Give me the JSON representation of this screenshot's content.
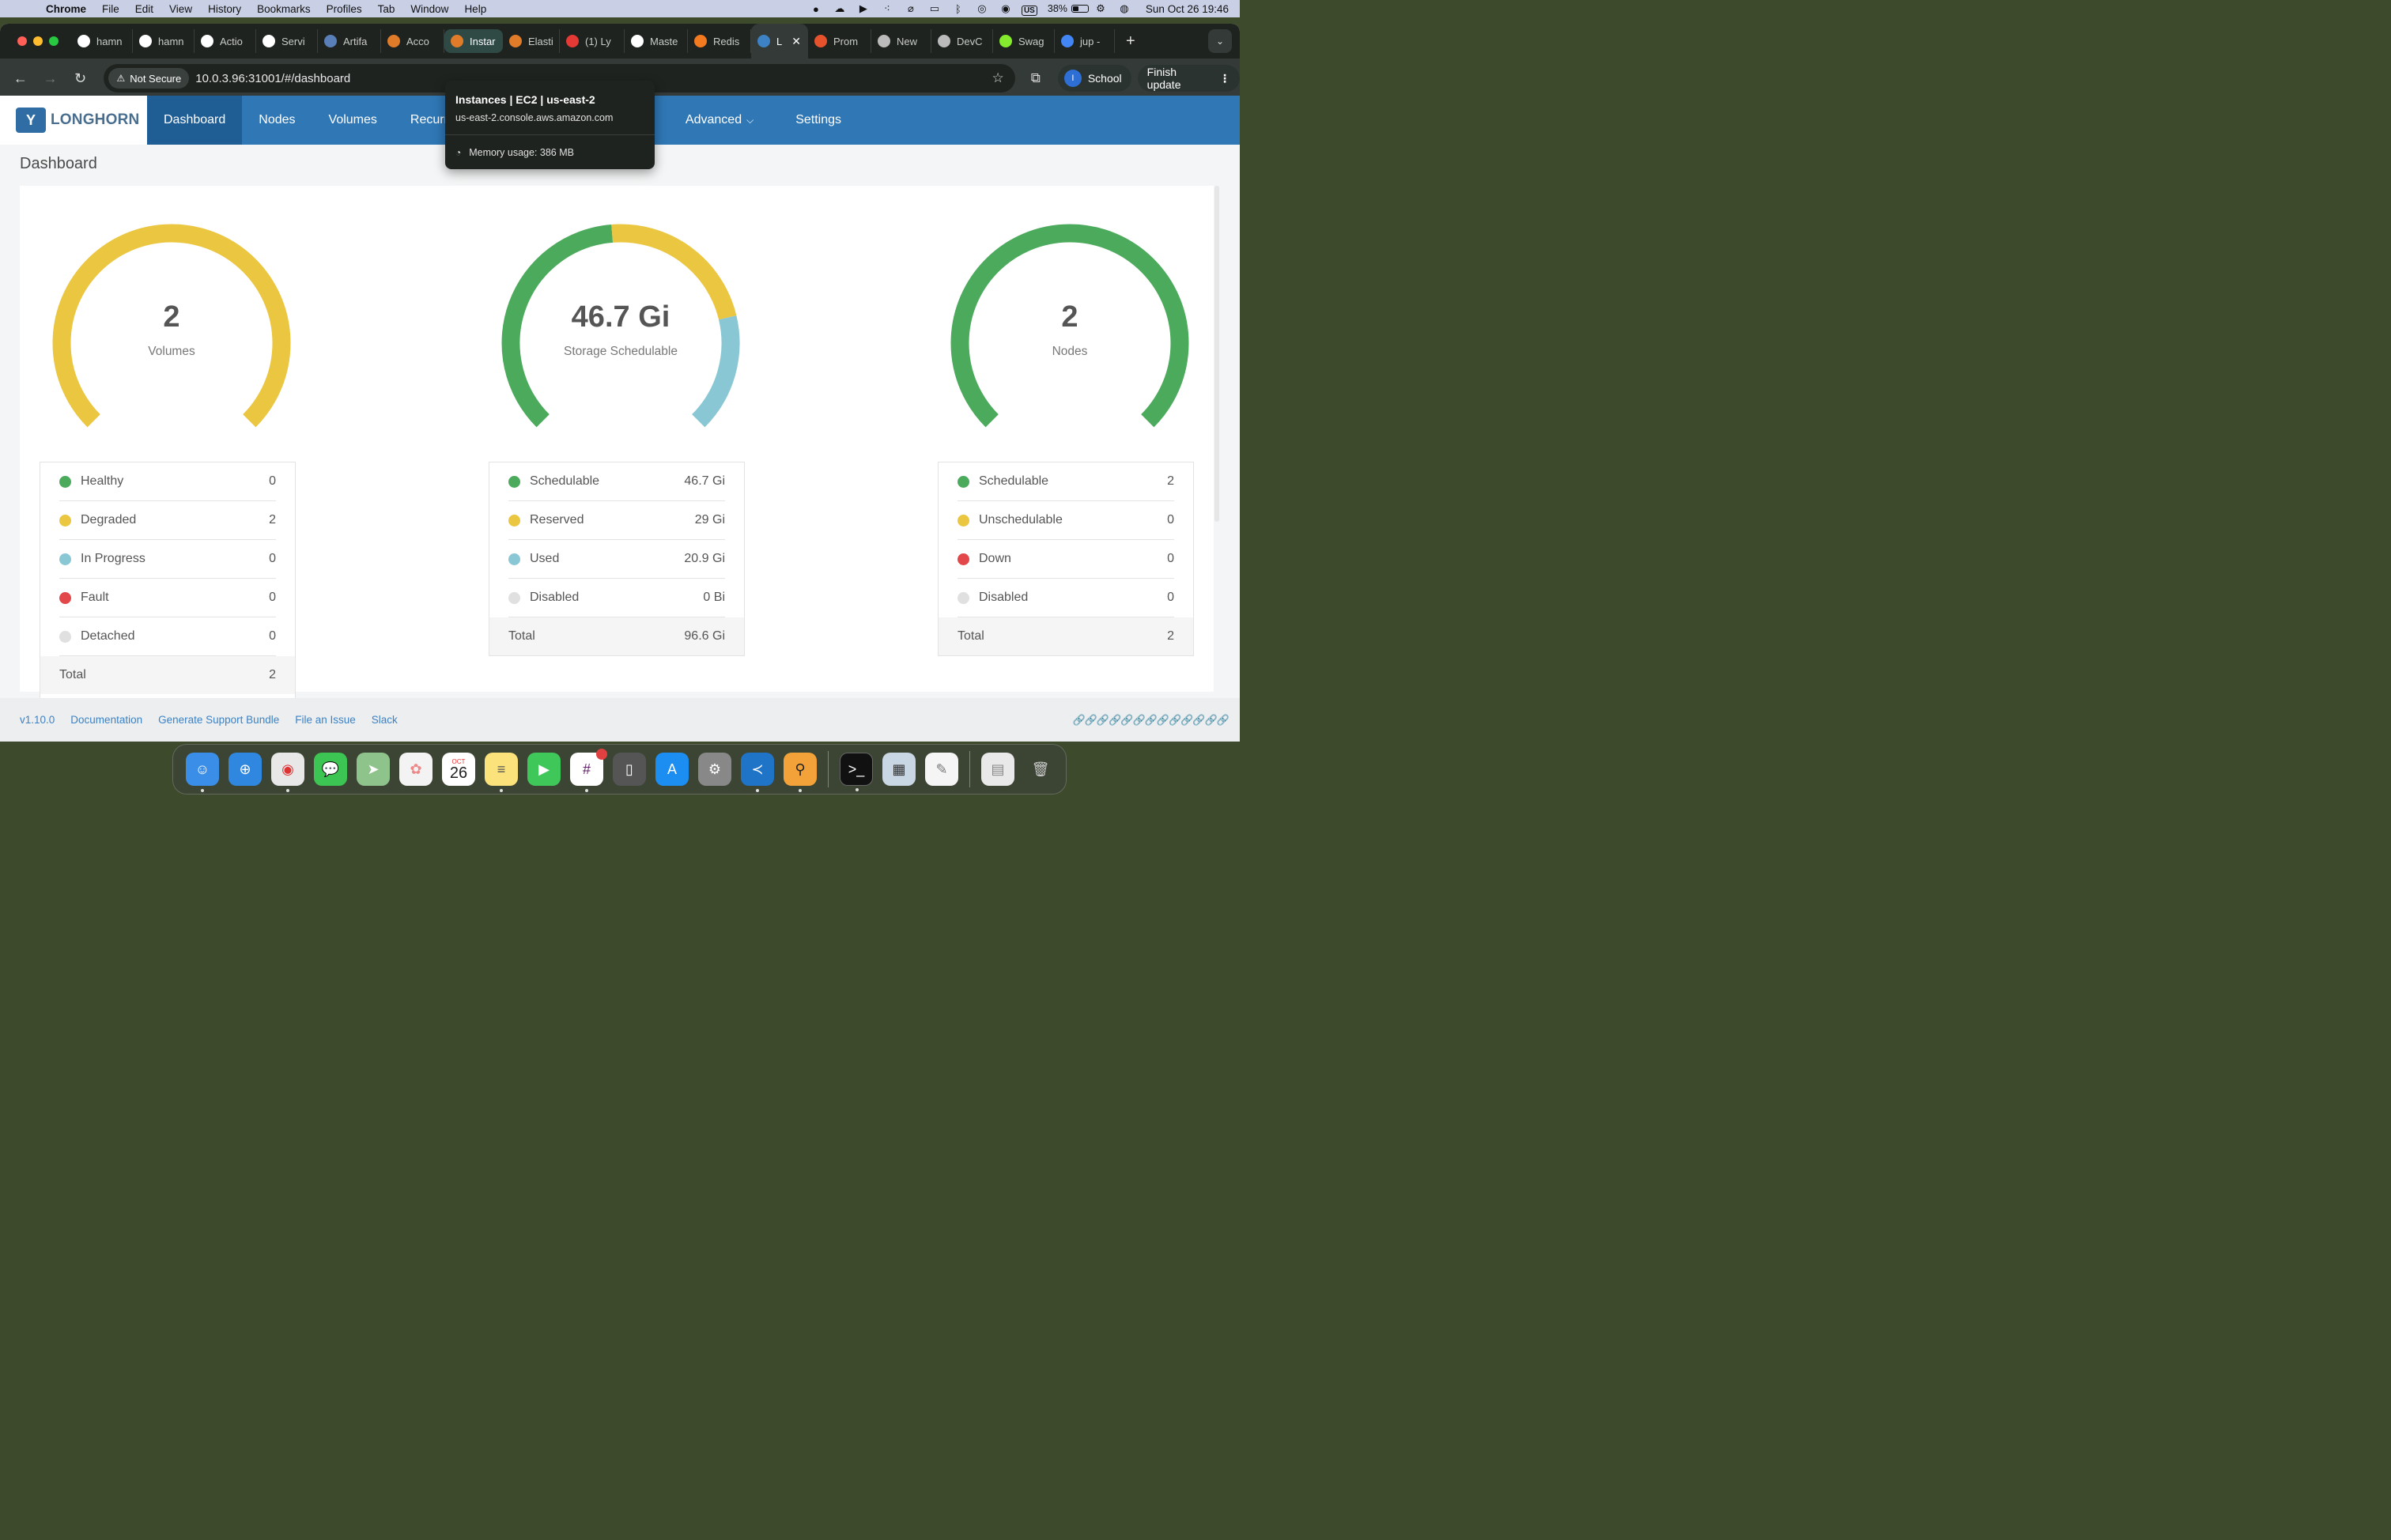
{
  "menubar": {
    "app": "Chrome",
    "items": [
      "File",
      "Edit",
      "View",
      "History",
      "Bookmarks",
      "Profiles",
      "Tab",
      "Window",
      "Help"
    ],
    "input_source": "US",
    "battery": "38%",
    "clock": "Sun Oct 26  19:46"
  },
  "tabs": [
    {
      "label": "hamn",
      "icon": "github-icon",
      "color": "#ffffff"
    },
    {
      "label": "hamn",
      "icon": "github-icon",
      "color": "#ffffff"
    },
    {
      "label": "Actio",
      "icon": "github-icon",
      "color": "#ffffff"
    },
    {
      "label": "Servi",
      "icon": "github-icon",
      "color": "#ffffff"
    },
    {
      "label": "Artifa",
      "icon": "artifact-icon",
      "color": "#5a7fb8"
    },
    {
      "label": "Acco",
      "icon": "aws-icon",
      "color": "#e07b2a"
    },
    {
      "label": "Instar",
      "icon": "ec2-icon",
      "color": "#e07b2a"
    },
    {
      "label": "Elasti",
      "icon": "elastic-icon",
      "color": "#e07b2a"
    },
    {
      "label": "(1) Ly",
      "icon": "youtube-icon",
      "color": "#e53935"
    },
    {
      "label": "Maste",
      "icon": "github-icon",
      "color": "#ffffff"
    },
    {
      "label": "Redis",
      "icon": "grafana-icon",
      "color": "#f47a20"
    },
    {
      "label": "L",
      "icon": "longhorn-icon",
      "color": "#3c82c4"
    },
    {
      "label": "Prom",
      "icon": "prometheus-icon",
      "color": "#e6522c"
    },
    {
      "label": "New",
      "icon": "chrome-icon",
      "color": "#bbbbbb"
    },
    {
      "label": "DevC",
      "icon": "globe-icon",
      "color": "#bbbbbb"
    },
    {
      "label": "Swag",
      "icon": "swagger-icon",
      "color": "#85ea2d"
    },
    {
      "label": "jup -",
      "icon": "google-icon",
      "color": "#4285f4"
    }
  ],
  "toolbar": {
    "not_secure": "Not Secure",
    "url": "10.0.3.96:31001/#/dashboard",
    "profile": "School",
    "profile_initial": "I",
    "finish_update": "Finish update"
  },
  "tooltip": {
    "title": "Instances | EC2 | us-east-2",
    "domain": "us-east-2.console.aws.amazon.com",
    "memory": "Memory usage: 386 MB"
  },
  "longhorn": {
    "logo": "LONGHORN",
    "nav": [
      "Dashboard",
      "Nodes",
      "Volumes",
      "Recurr",
      "Advanced",
      "Settings"
    ],
    "page_title": "Dashboard"
  },
  "colors": {
    "green": "#4caa5c",
    "yellow": "#ebc641",
    "blue": "#88c7d3",
    "red": "#e2484a",
    "grey": "#e0e0e0"
  },
  "volumes": {
    "value": "2",
    "label": "Volumes",
    "rows": [
      {
        "label": "Healthy",
        "value": "0",
        "color": "#4caa5c"
      },
      {
        "label": "Degraded",
        "value": "2",
        "color": "#ebc641"
      },
      {
        "label": "In Progress",
        "value": "0",
        "color": "#88c7d3"
      },
      {
        "label": "Fault",
        "value": "0",
        "color": "#e2484a"
      },
      {
        "label": "Detached",
        "value": "0",
        "color": "#e0e0e0"
      }
    ],
    "total_label": "Total",
    "total_value": "2"
  },
  "storage": {
    "value": "46.7 Gi",
    "label": "Storage Schedulable",
    "rows": [
      {
        "label": "Schedulable",
        "value": "46.7 Gi",
        "color": "#4caa5c"
      },
      {
        "label": "Reserved",
        "value": "29 Gi",
        "color": "#ebc641"
      },
      {
        "label": "Used",
        "value": "20.9 Gi",
        "color": "#88c7d3"
      },
      {
        "label": "Disabled",
        "value": "0 Bi",
        "color": "#e0e0e0"
      }
    ],
    "total_label": "Total",
    "total_value": "96.6 Gi"
  },
  "nodes": {
    "value": "2",
    "label": "Nodes",
    "rows": [
      {
        "label": "Schedulable",
        "value": "2",
        "color": "#4caa5c"
      },
      {
        "label": "Unschedulable",
        "value": "0",
        "color": "#ebc641"
      },
      {
        "label": "Down",
        "value": "0",
        "color": "#e2484a"
      },
      {
        "label": "Disabled",
        "value": "0",
        "color": "#e0e0e0"
      }
    ],
    "total_label": "Total",
    "total_value": "2"
  },
  "footer": {
    "version": "v1.10.0",
    "links": [
      "Documentation",
      "Generate Support Bundle",
      "File an Issue",
      "Slack"
    ]
  },
  "dock": {
    "calendar_month": "OCT",
    "calendar_day": "26"
  }
}
